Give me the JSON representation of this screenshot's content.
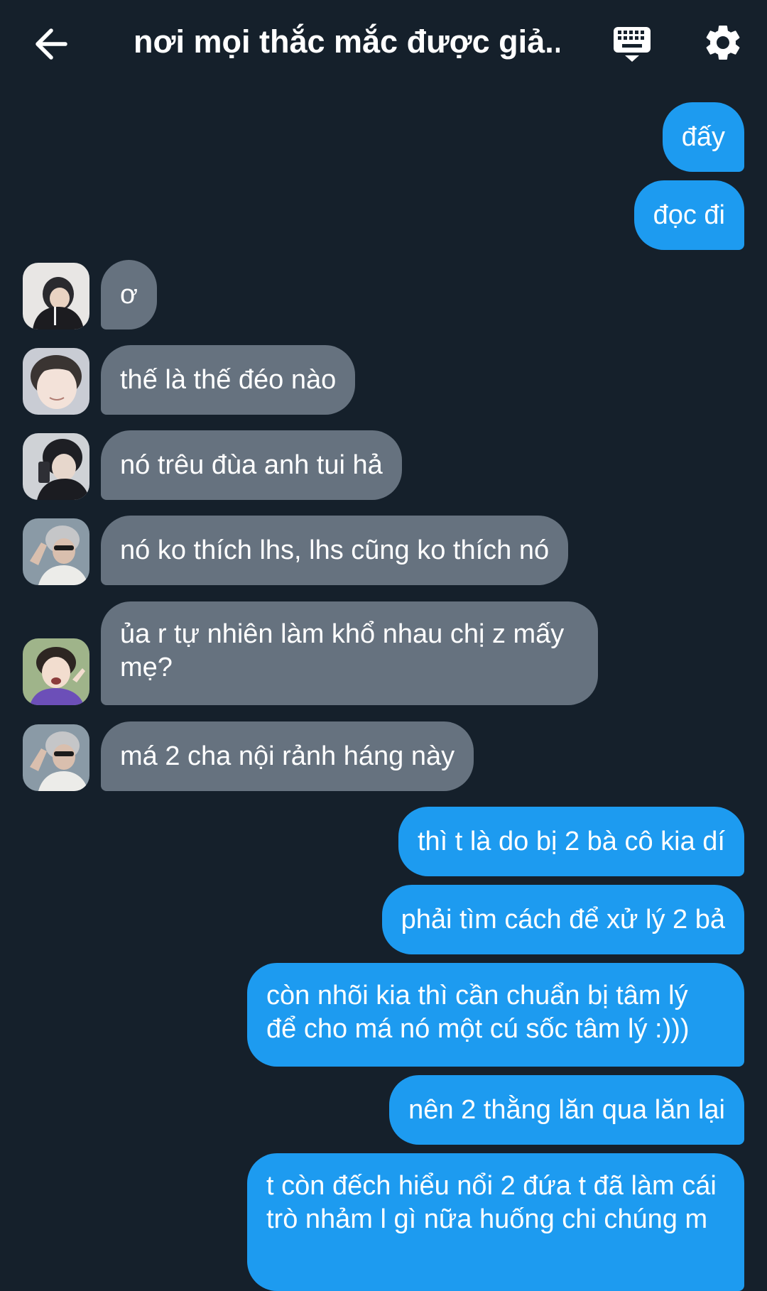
{
  "header": {
    "title": "nơi mọi thắc mắc được giả...",
    "back_icon": "arrow-left-icon",
    "keyboard_icon": "keyboard-icon",
    "settings_icon": "gear-icon"
  },
  "colors": {
    "background": "#15202b",
    "outgoing_bubble": "#1d9bf0",
    "incoming_bubble": "#66727f",
    "text": "#ffffff"
  },
  "messages": [
    {
      "direction": "outgoing",
      "text": "đấy"
    },
    {
      "direction": "outgoing",
      "text": "đọc đi"
    },
    {
      "direction": "incoming",
      "text": "ơ"
    },
    {
      "direction": "incoming",
      "text": "thế là thế đéo nào"
    },
    {
      "direction": "incoming",
      "text": "nó trêu đùa anh tui hả"
    },
    {
      "direction": "incoming",
      "text": "nó ko thích lhs, lhs cũng ko thích nó"
    },
    {
      "direction": "incoming",
      "text": "ủa r tự nhiên làm khổ nhau chị z mấy mẹ?"
    },
    {
      "direction": "incoming",
      "text": "má 2 cha nội rảnh háng này"
    },
    {
      "direction": "outgoing",
      "text": "thì t là do bị 2 bà cô kia dí"
    },
    {
      "direction": "outgoing",
      "text": "phải tìm cách để xử lý 2 bả"
    },
    {
      "direction": "outgoing",
      "text": "còn nhõi kia thì cần chuẩn bị tâm lý để cho má nó một cú sốc tâm lý :)))"
    },
    {
      "direction": "outgoing",
      "text": "nên 2 thằng lăn qua lăn lại"
    },
    {
      "direction": "outgoing",
      "text": "t còn đếch hiểu nổi 2 đứa t đã làm cái trò nhảm l gì nữa huống chi chúng m"
    }
  ]
}
